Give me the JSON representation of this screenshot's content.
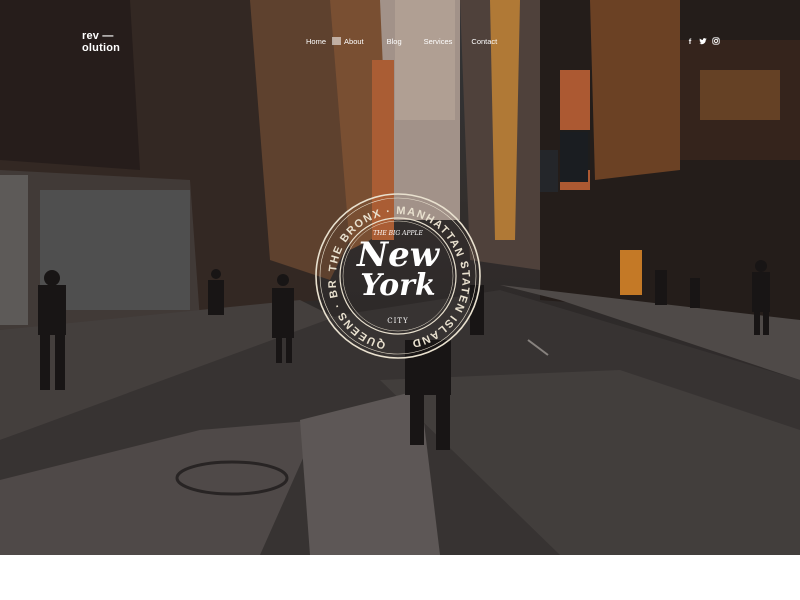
{
  "brand": {
    "line1": "rev —",
    "line2": "olution"
  },
  "nav": {
    "home": "Home",
    "about": "About",
    "blog": "Blog",
    "services": "Services",
    "contact": "Contact"
  },
  "social": {
    "facebook": {
      "glyph": "f",
      "icon": "facebook-icon"
    },
    "twitter": {
      "glyph": "🐦",
      "icon": "twitter-icon"
    },
    "instagram": {
      "glyph": "◎",
      "icon": "instagram-icon"
    }
  },
  "badge": {
    "ring_top": "THE BRONX · MANHATTAN ·",
    "ring_right": "STATEN ISLAND ·",
    "ring_left": "QUEENS · BROOKLYN ·",
    "tagline": "THE BIG APPLE",
    "word1": "New",
    "word2": "York",
    "word3": "CITY"
  },
  "colors": {
    "text": "#ffffff",
    "footer": "#ffffff",
    "badge_ring": "#e9e1cf"
  }
}
